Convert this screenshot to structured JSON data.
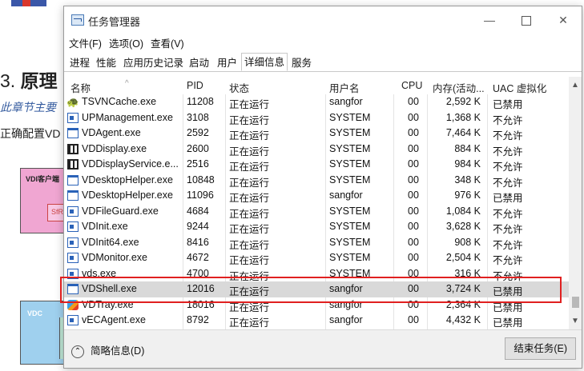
{
  "background_doc": {
    "heading_num": "3.",
    "heading_text": "原理",
    "line1": "此章节主要",
    "line2": "正确配置VD",
    "box1_label": "VDI客户端",
    "box1_inner": "SfRe",
    "box2_label": "VDC"
  },
  "window": {
    "title": "任务管理器",
    "controls": {
      "minimize": "—",
      "close": "✕"
    },
    "menu": [
      "文件(F)",
      "选项(O)",
      "查看(V)"
    ],
    "tabs": [
      "进程",
      "性能",
      "应用历史记录",
      "启动",
      "用户",
      "详细信息",
      "服务"
    ],
    "active_tab": "详细信息"
  },
  "table": {
    "columns": [
      "名称",
      "PID",
      "状态",
      "用户名",
      "CPU",
      "内存(活动...",
      "UAC 虚拟化"
    ],
    "sort_indicator": "^",
    "rows": [
      {
        "icon": "tsvn-icon",
        "name": "TSVNCache.exe",
        "pid": "11208",
        "status": "正在运行",
        "user": "sangfor",
        "cpu": "00",
        "mem": "2,592 K",
        "uac": "已禁用"
      },
      {
        "icon": "app-icon",
        "name": "UPManagement.exe",
        "pid": "3108",
        "status": "正在运行",
        "user": "SYSTEM",
        "cpu": "00",
        "mem": "1,368 K",
        "uac": "不允许"
      },
      {
        "icon": "window-icon",
        "name": "VDAgent.exe",
        "pid": "2592",
        "status": "正在运行",
        "user": "SYSTEM",
        "cpu": "00",
        "mem": "7,464 K",
        "uac": "不允许"
      },
      {
        "icon": "grid-icon",
        "name": "VDDisplay.exe",
        "pid": "2600",
        "status": "正在运行",
        "user": "SYSTEM",
        "cpu": "00",
        "mem": "884 K",
        "uac": "不允许"
      },
      {
        "icon": "grid-icon",
        "name": "VDDisplayService.e...",
        "pid": "2516",
        "status": "正在运行",
        "user": "SYSTEM",
        "cpu": "00",
        "mem": "984 K",
        "uac": "不允许"
      },
      {
        "icon": "window-icon",
        "name": "VDesktopHelper.exe",
        "pid": "10848",
        "status": "正在运行",
        "user": "SYSTEM",
        "cpu": "00",
        "mem": "348 K",
        "uac": "不允许"
      },
      {
        "icon": "window-icon",
        "name": "VDesktopHelper.exe",
        "pid": "11096",
        "status": "正在运行",
        "user": "sangfor",
        "cpu": "00",
        "mem": "976 K",
        "uac": "已禁用"
      },
      {
        "icon": "app-icon",
        "name": "VDFileGuard.exe",
        "pid": "4684",
        "status": "正在运行",
        "user": "SYSTEM",
        "cpu": "00",
        "mem": "1,084 K",
        "uac": "不允许"
      },
      {
        "icon": "app-icon",
        "name": "VDInit.exe",
        "pid": "9244",
        "status": "正在运行",
        "user": "SYSTEM",
        "cpu": "00",
        "mem": "3,628 K",
        "uac": "不允许"
      },
      {
        "icon": "app-icon",
        "name": "VDInit64.exe",
        "pid": "8416",
        "status": "正在运行",
        "user": "SYSTEM",
        "cpu": "00",
        "mem": "908 K",
        "uac": "不允许"
      },
      {
        "icon": "app-icon",
        "name": "VDMonitor.exe",
        "pid": "4672",
        "status": "正在运行",
        "user": "SYSTEM",
        "cpu": "00",
        "mem": "2,504 K",
        "uac": "不允许"
      },
      {
        "icon": "app-icon",
        "name": "vds.exe",
        "pid": "4700",
        "status": "正在运行",
        "user": "SYSTEM",
        "cpu": "00",
        "mem": "316 K",
        "uac": "不允许"
      },
      {
        "icon": "window-icon",
        "name": "VDShell.exe",
        "pid": "12016",
        "status": "正在运行",
        "user": "sangfor",
        "cpu": "00",
        "mem": "3,724 K",
        "uac": "已禁用",
        "selected": true
      },
      {
        "icon": "tray-icon",
        "name": "VDTray.exe",
        "pid": "18016",
        "status": "正在运行",
        "user": "sangfor",
        "cpu": "00",
        "mem": "2,364 K",
        "uac": "已禁用"
      },
      {
        "icon": "app-icon",
        "name": "vECAgent.exe",
        "pid": "8792",
        "status": "正在运行",
        "user": "sangfor",
        "cpu": "00",
        "mem": "4,432 K",
        "uac": "已禁用"
      }
    ]
  },
  "footer": {
    "fewer_details": "简略信息(D)",
    "end_task": "结束任务(E)"
  },
  "colors": {
    "highlight": "#e02020",
    "selected_row": "#d9d9d9",
    "icon_blue": "#2a62b8"
  }
}
